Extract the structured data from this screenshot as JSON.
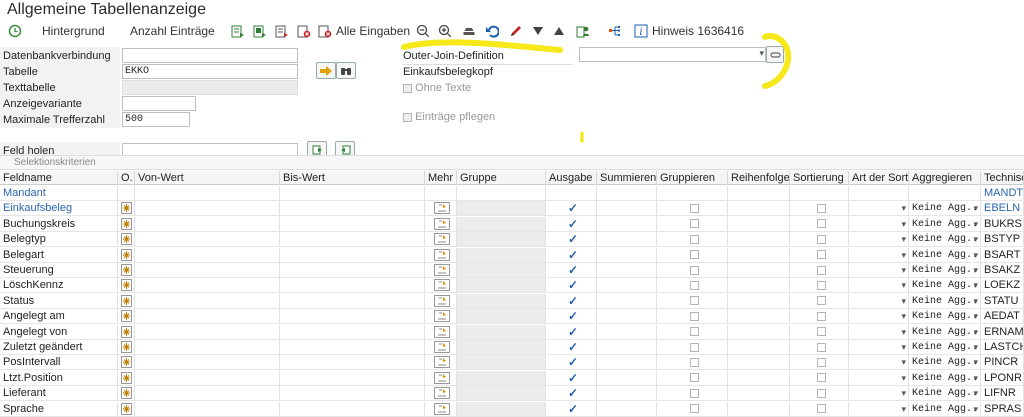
{
  "window": {
    "title": "Allgemeine Tabellenanzeige"
  },
  "toolbar": {
    "hintergrund": "Hintergrund",
    "anzahl": "Anzahl Einträge",
    "alle_eingaben": "Alle Eingaben",
    "hinweis": "Hinweis 1636416"
  },
  "form": {
    "datenbank_label": "Datenbankverbindung",
    "tabelle_label": "Tabelle",
    "tabelle_value": "EKKO",
    "texttabelle_label": "Texttabelle",
    "anzeigevariante_label": "Anzeigevariante",
    "trefferzahl_label": "Maximale Trefferzahl",
    "trefferzahl_value": "500",
    "outer_join_label": "Outer-Join-Definition",
    "einkaufsbelegkopf": "Einkaufsbelegkopf",
    "ohne_texte": "Ohne Texte",
    "eintraege_pflegen": "Einträge pflegen",
    "feld_holen_label": "Feld holen"
  },
  "section": {
    "title": "Selektionskriterien"
  },
  "grid": {
    "headers": [
      "Feldname",
      "O.",
      "Von-Wert",
      "Bis-Wert",
      "Mehr",
      "Gruppe",
      "Ausgabe",
      "Summieren",
      "Gruppieren",
      "Reihenfolge",
      "Sortierung",
      "Art der Sort...",
      "Aggregieren",
      "Technisch"
    ],
    "agg_value": "Keine Agg...",
    "rows": [
      {
        "name": "Mandant",
        "tech": "MANDT",
        "type": "header"
      },
      {
        "name": "Einkaufsbeleg",
        "tech": "EBELN",
        "type": "key"
      },
      {
        "name": "Buchungskreis",
        "tech": "BUKRS",
        "type": "normal"
      },
      {
        "name": "Belegtyp",
        "tech": "BSTYP",
        "type": "normal"
      },
      {
        "name": "Belegart",
        "tech": "BSART",
        "type": "normal"
      },
      {
        "name": "Steuerung",
        "tech": "BSAKZ",
        "type": "normal"
      },
      {
        "name": "LöschKennz",
        "tech": "LOEKZ",
        "type": "normal"
      },
      {
        "name": "Status",
        "tech": "STATU",
        "type": "normal"
      },
      {
        "name": "Angelegt am",
        "tech": "AEDAT",
        "type": "normal"
      },
      {
        "name": "Angelegt von",
        "tech": "ERNAM",
        "type": "normal"
      },
      {
        "name": "Zuletzt geändert",
        "tech": "LASTCHAN",
        "type": "normal"
      },
      {
        "name": "PosIntervall",
        "tech": "PINCR",
        "type": "normal"
      },
      {
        "name": "Ltzt.Position",
        "tech": "LPONR",
        "type": "normal"
      },
      {
        "name": "Lieferant",
        "tech": "LIFNR",
        "type": "normal"
      },
      {
        "name": "Sprache",
        "tech": "SPRAS",
        "type": "normal"
      }
    ]
  },
  "colors": {
    "annotation": "#f5e600",
    "accent": "#2a67b1"
  }
}
